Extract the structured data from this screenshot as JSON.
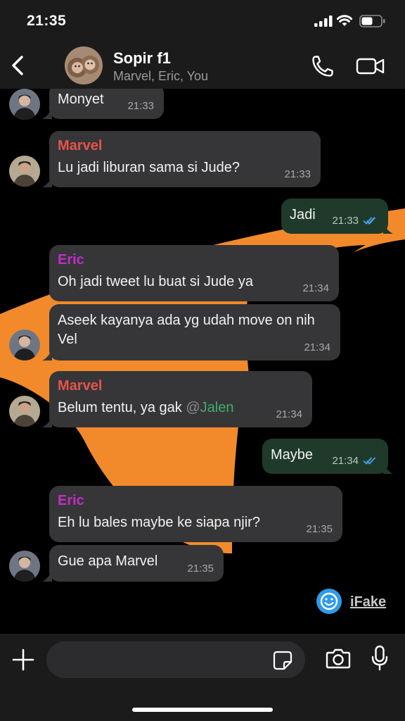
{
  "status_bar": {
    "time": "21:35"
  },
  "header": {
    "title": "Sopir f1",
    "subtitle": "Marvel, Eric, You"
  },
  "colors": {
    "marvel": "#e5534b",
    "eric": "#c02ec8",
    "mention": "#3fae69",
    "read_ticks": "#4aa3f0",
    "wallpaper_swoosh": "#f28a2b"
  },
  "messages": [
    {
      "text": "Monyet",
      "time": "21:33"
    },
    {
      "sender": "Marvel",
      "text": "Lu jadi liburan sama si Jude?",
      "time": "21:33"
    },
    {
      "text": "Jadi",
      "time": "21:33"
    },
    {
      "sender": "Eric",
      "text": "Oh jadi tweet lu buat si Jude ya",
      "time": "21:34"
    },
    {
      "text": "Aseek kayanya ada yg udah move on nih Vel",
      "time": "21:34"
    },
    {
      "sender": "Marvel",
      "text": "Belum tentu, ya gak",
      "mention_at": "@",
      "mention_name": "Jalen",
      "time": "21:34"
    },
    {
      "text": "Maybe",
      "time": "21:34"
    },
    {
      "sender": "Eric",
      "text": "Eh lu bales maybe ke siapa njir?",
      "time": "21:35"
    },
    {
      "text": "Gue apa Marvel",
      "time": "21:35"
    }
  ],
  "watermark": {
    "label": "iFake"
  },
  "composer": {
    "value": "",
    "placeholder": ""
  }
}
